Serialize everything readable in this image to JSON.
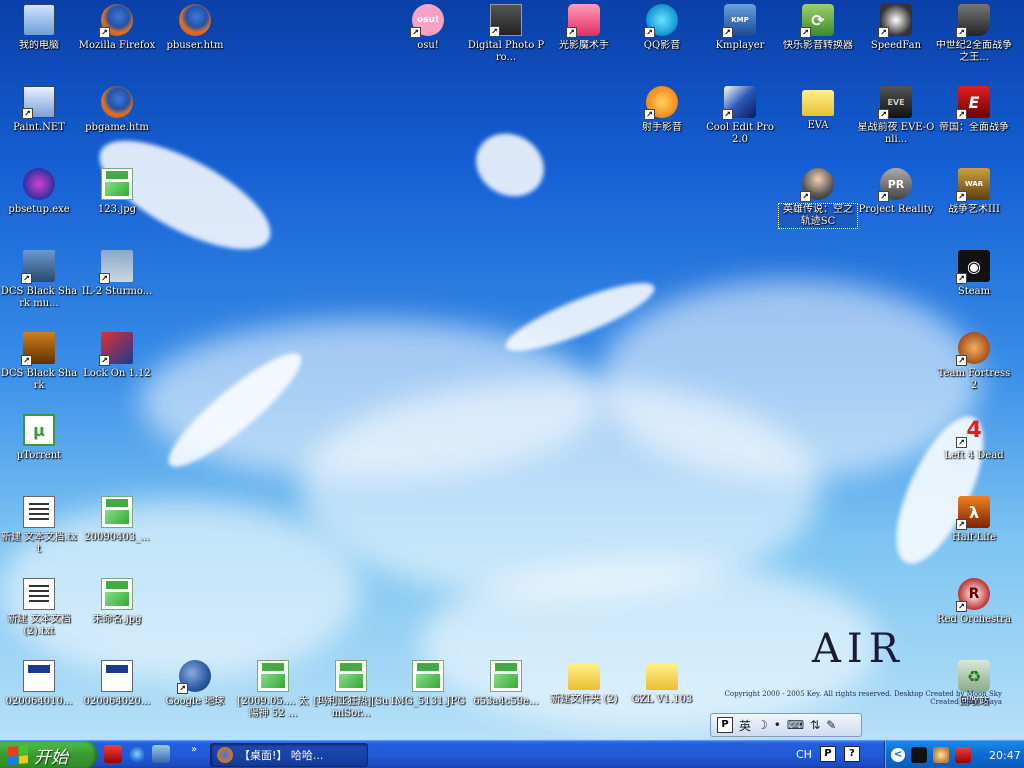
{
  "desktop": {
    "icons": [
      {
        "label": "我的电脑",
        "icon": "computer-icon",
        "style": "i-pc",
        "glyph": "",
        "shortcut": false
      },
      {
        "label": "Mozilla Firefox",
        "icon": "firefox-icon",
        "style": "i-ff",
        "glyph": "",
        "shortcut": true
      },
      {
        "label": "pbuser.htm",
        "icon": "html-file-icon",
        "style": "i-ff",
        "glyph": "",
        "shortcut": false
      },
      {
        "label": "osu!",
        "icon": "osu-icon",
        "style": "i-osu",
        "glyph": "osu!",
        "shortcut": true
      },
      {
        "label": "Digital Photo Pro...",
        "icon": "camera-icon",
        "style": "i-photo",
        "glyph": "",
        "shortcut": true
      },
      {
        "label": "光影魔术手",
        "icon": "photo-editor-icon",
        "style": "i-pink",
        "glyph": "",
        "shortcut": true
      },
      {
        "label": "QQ影音",
        "icon": "qq-player-icon",
        "style": "i-qq",
        "glyph": "",
        "shortcut": true
      },
      {
        "label": "Kmplayer",
        "icon": "kmplayer-icon",
        "style": "i-kmp",
        "glyph": "KMP",
        "shortcut": true
      },
      {
        "label": "快乐影音转换器",
        "icon": "converter-icon",
        "style": "i-green",
        "glyph": "⟳",
        "shortcut": true
      },
      {
        "label": "SpeedFan",
        "icon": "fan-icon",
        "style": "i-fan",
        "glyph": "",
        "shortcut": true
      },
      {
        "label": "中世纪2全面战争之王...",
        "icon": "shield-icon",
        "style": "i-shield",
        "glyph": "",
        "shortcut": true
      },
      {
        "label": "Paint.NET",
        "icon": "paint-icon",
        "style": "i-paint",
        "glyph": "",
        "shortcut": true
      },
      {
        "label": "pbgame.htm",
        "icon": "html-file-icon",
        "style": "i-ff",
        "glyph": "",
        "shortcut": false
      },
      {
        "label": "射手影音",
        "icon": "player-icon",
        "style": "i-orange",
        "glyph": "",
        "shortcut": true
      },
      {
        "label": "Cool Edit Pro 2.0",
        "icon": "audio-editor-icon",
        "style": "i-cool",
        "glyph": "",
        "shortcut": true
      },
      {
        "label": "EVA",
        "icon": "folder-icon",
        "style": "i-folder",
        "glyph": "",
        "shortcut": false
      },
      {
        "label": "星战前夜 EVE-Onli...",
        "icon": "eve-icon",
        "style": "i-eve",
        "glyph": "EVE",
        "shortcut": true
      },
      {
        "label": "帝国：全面战争",
        "icon": "empire-icon",
        "style": "i-empire",
        "glyph": "E",
        "shortcut": true
      },
      {
        "label": "pbsetup.exe",
        "icon": "setup-icon",
        "style": "i-setup",
        "glyph": "",
        "shortcut": false
      },
      {
        "label": "123.jpg",
        "icon": "jpeg-file-icon",
        "style": "i-jpg",
        "glyph": "",
        "shortcut": false
      },
      {
        "label": "英雄传说：空之轨迹SC",
        "icon": "anime-character-icon",
        "style": "i-anime",
        "glyph": "",
        "shortcut": true
      },
      {
        "label": "Project Reality",
        "icon": "project-reality-icon",
        "style": "i-pr",
        "glyph": "PR",
        "shortcut": true
      },
      {
        "label": "战争艺术III",
        "icon": "war-game-icon",
        "style": "i-war",
        "glyph": "WAR",
        "shortcut": true
      },
      {
        "label": "DCS Black Shark mu...",
        "icon": "jet-icon",
        "style": "i-jet",
        "glyph": "",
        "shortcut": true
      },
      {
        "label": "IL-2 Sturmo...",
        "icon": "plane-icon",
        "style": "i-il2",
        "glyph": "",
        "shortcut": true
      },
      {
        "label": "Steam",
        "icon": "steam-icon",
        "style": "i-steam",
        "glyph": "◉",
        "shortcut": true
      },
      {
        "label": "DCS Black Shark",
        "icon": "helicopter-icon",
        "style": "i-dcs2",
        "glyph": "",
        "shortcut": true
      },
      {
        "label": "Lock On 1.12",
        "icon": "lock-on-icon",
        "style": "i-lock",
        "glyph": "",
        "shortcut": true
      },
      {
        "label": "Team Fortress 2",
        "icon": "tf2-icon",
        "style": "i-tf2",
        "glyph": "",
        "shortcut": true
      },
      {
        "label": "µTorrent",
        "icon": "utorrent-icon",
        "style": "i-utor",
        "glyph": "µ",
        "shortcut": false
      },
      {
        "label": "Left 4 Dead",
        "icon": "left4dead-icon",
        "style": "i-l4d",
        "glyph": "4",
        "shortcut": true
      },
      {
        "label": "新建 文本文档.txt",
        "icon": "text-file-icon",
        "style": "i-txt",
        "glyph": "",
        "shortcut": false
      },
      {
        "label": "20090403_...",
        "icon": "jpeg-file-icon",
        "style": "i-jpg",
        "glyph": "",
        "shortcut": false
      },
      {
        "label": "Half-Life",
        "icon": "half-life-icon",
        "style": "i-hl",
        "glyph": "λ",
        "shortcut": true
      },
      {
        "label": "新建 文本文档 (2).txt",
        "icon": "text-file-icon",
        "style": "i-txt",
        "glyph": "",
        "shortcut": false
      },
      {
        "label": "未命名.jpg",
        "icon": "jpeg-file-icon",
        "style": "i-jpg",
        "glyph": "",
        "shortcut": false
      },
      {
        "label": "Red Orchestra",
        "icon": "red-orchestra-icon",
        "style": "i-red",
        "glyph": "R",
        "shortcut": true
      },
      {
        "label": "020064010...",
        "icon": "html-file-icon",
        "style": "i-htmlfile",
        "glyph": "",
        "shortcut": false
      },
      {
        "label": "020064020...",
        "icon": "html-file-icon",
        "style": "i-htmlfile",
        "glyph": "",
        "shortcut": false
      },
      {
        "label": "Google 地球",
        "icon": "google-earth-icon",
        "style": "i-ge",
        "glyph": "",
        "shortcut": true
      },
      {
        "label": "[2009.05.... 太陽神 52 ...",
        "icon": "jpeg-file-icon",
        "style": "i-jpg",
        "glyph": "",
        "shortcut": false
      },
      {
        "label": "[玛利亚狂热][SumiSor...",
        "icon": "jpeg-file-icon",
        "style": "i-jpg",
        "glyph": "",
        "shortcut": false
      },
      {
        "label": "IMG_5131.JPG",
        "icon": "jpeg-file-icon",
        "style": "i-jpg",
        "glyph": "",
        "shortcut": false
      },
      {
        "label": "653a4c59e...",
        "icon": "jpeg-file-icon",
        "style": "i-jpg",
        "glyph": "",
        "shortcut": false
      },
      {
        "label": "新建文件夹 (2)",
        "icon": "folder-icon",
        "style": "i-folder",
        "glyph": "",
        "shortcut": false
      },
      {
        "label": "GZL V1.103",
        "icon": "folder-icon",
        "style": "i-folder",
        "glyph": "",
        "shortcut": false
      },
      {
        "label": "回收站",
        "icon": "recycle-bin-icon",
        "style": "i-recycle",
        "glyph": "♻",
        "shortcut": false
      }
    ],
    "wallpaper": {
      "logo": "AIR",
      "copyright": "Copyright 2000 - 2005 Key. All rights reserved. Desktop Created by Moon Sky Created using Maya"
    }
  },
  "language_bar": {
    "ime_mark": "P",
    "lang": "英",
    "moon": "☽",
    "items": [
      "•",
      "⌨",
      "⇅",
      "✎"
    ]
  },
  "taskbar": {
    "start_label": "开始",
    "quick_launch_chevron": "»",
    "task_label": "【桌面!】 哈哈...",
    "tray_lang": "CH",
    "tray_ime": "P",
    "tray_help": "?",
    "tray_back": "<",
    "clock": "20:47"
  }
}
